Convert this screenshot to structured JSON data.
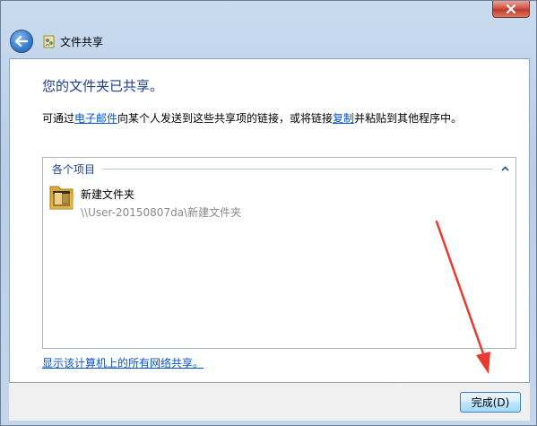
{
  "window": {
    "title": "文件共享"
  },
  "content": {
    "heading": "您的文件夹已共享。",
    "desc_prefix": "可通过",
    "email_link": "电子邮件",
    "desc_middle": "向某个人发送到这些共享项的链接，或将链接",
    "copy_link": "复制",
    "desc_suffix": "并粘贴到其他程序中。"
  },
  "items": {
    "group_label": "各个项目",
    "list": [
      {
        "name": "新建文件夹",
        "path": "\\\\User-20150807da\\新建文件夹"
      }
    ]
  },
  "footer": {
    "all_shares_link": "显示该计算机上的所有网络共享。",
    "finish_button": "完成(D)"
  },
  "colors": {
    "heading": "#1e3f8f",
    "link": "#0a53c2",
    "annotation_arrow": "#e83a2e"
  },
  "icons": {
    "back": "back-arrow-icon",
    "app": "file-sharing-icon",
    "close": "close-icon",
    "collapse": "chevron-up-icon",
    "folder": "folder-icon"
  }
}
